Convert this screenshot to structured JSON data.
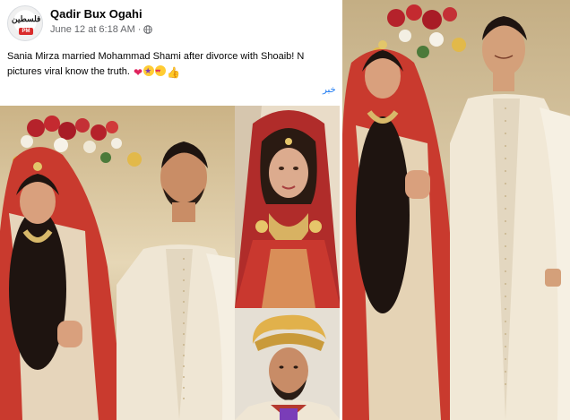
{
  "post": {
    "author": "Qadir Bux Ogahi",
    "timestamp": "June 12 at 6:18 AM",
    "separator": "·",
    "privacy_icon": "globe-icon",
    "caption_line1": "Sania Mirza married Mohammad Shami after divorce with Shoaib! N",
    "caption_line2": "pictures viral know the truth.",
    "emojis": [
      "red-heart-emoji",
      "star-struck-emoji",
      "heart-eyes-emoji",
      "thumbs-up-emoji"
    ],
    "translate_link": "خبر",
    "avatar_logo_text": "فلسطین",
    "avatar_badge": "PM"
  },
  "colors": {
    "author": "#050505",
    "meta": "#65676b",
    "link": "#1877f2"
  }
}
